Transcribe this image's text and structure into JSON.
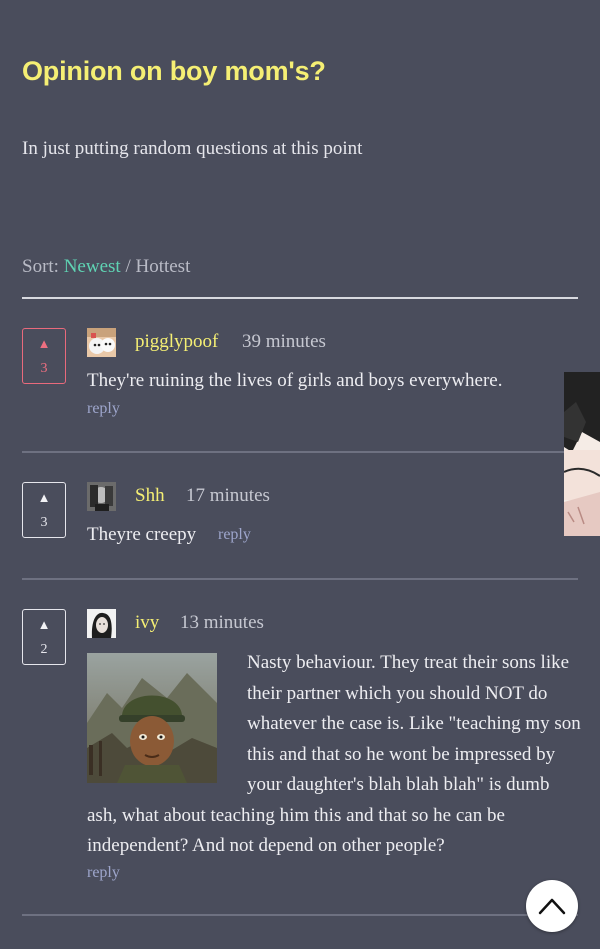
{
  "post": {
    "title": "Opinion on boy mom's?",
    "body": "In just putting random questions at this point"
  },
  "sort": {
    "label": "Sort:",
    "options": [
      "Newest",
      "Hottest"
    ],
    "separator": "/",
    "active": "Newest"
  },
  "comments": [
    {
      "author": "pigglypoof",
      "time": "39 minutes",
      "votes": "3",
      "upvoted": true,
      "text": "They're ruining the lives of girls and boys everywhere.",
      "reply_label": "reply"
    },
    {
      "author": "Shh",
      "time": "17 minutes",
      "votes": "3",
      "upvoted": false,
      "text": "Theyre creepy",
      "reply_label": "reply"
    },
    {
      "author": "ivy",
      "time": "13 minutes",
      "votes": "2",
      "upvoted": false,
      "text": "Nasty behaviour. They treat their sons like their partner which you should NOT do whatever the case is. Like \"teaching my son this and that so he wont be impressed by your daughter's blah blah blah\" is dumb ash, what about teaching him this and that so he can be independent? And not depend on other people?",
      "reply_label": "reply"
    }
  ],
  "icons": {
    "upvote": "triangle-up-icon",
    "scroll_top": "chevron-up-icon"
  },
  "colors": {
    "background": "#4a4d5c",
    "title": "#f5ef74",
    "author": "#f5ef74",
    "active_sort": "#5fd3b3",
    "reply": "#9ea6cc",
    "upvoted": "#ee6f80"
  }
}
